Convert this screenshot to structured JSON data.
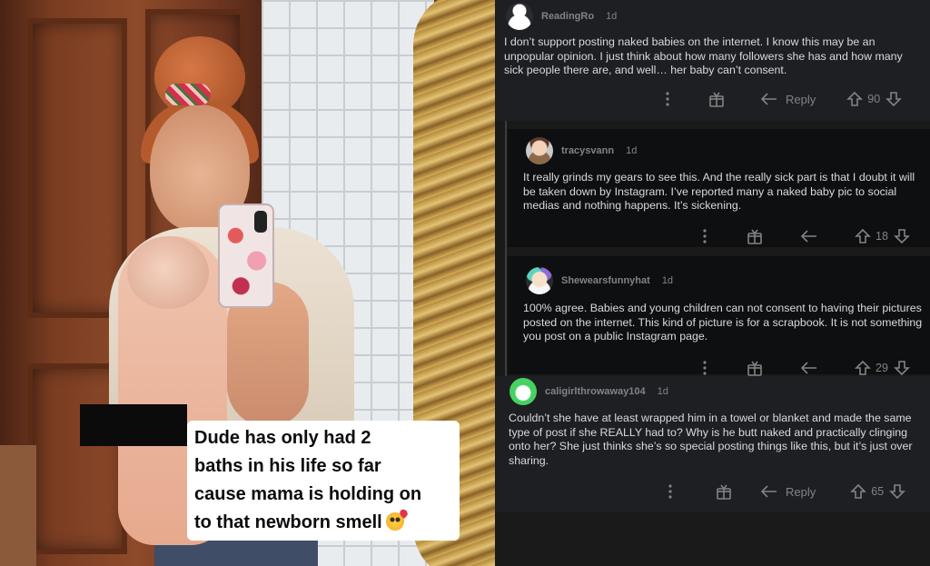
{
  "photo": {
    "caption_lines": [
      "Dude has only had 2",
      "baths in his life so far",
      "cause mama is holding on",
      "to that newborn smell"
    ],
    "caption_emoji": "smiling-face-with-hearts-icon"
  },
  "comments": [
    {
      "username": "ReadingRo",
      "age": "1d",
      "body": "I don’t support posting naked babies on the internet. I know this may be an unpopular opinion. I just think about how many followers she has and how many sick people there are, and well… her baby can’t consent.",
      "reply_label": "Reply",
      "votes": "90"
    },
    {
      "username": "tracysvann",
      "age": "1d",
      "body": "It really grinds my gears to see this. And the really sick part is that I doubt it will be taken down by Instagram. I’ve reported many a naked baby pic to social medias and nothing happens. It’s sickening.",
      "votes": "18"
    },
    {
      "username": "Shewearsfunnyhat",
      "age": "1d",
      "body": "100% agree. Babies and young children can not consent to having their pictures posted on the internet. This kind of picture is for a scrapbook. It is not something you post on a public Instagram page.",
      "votes": "29"
    },
    {
      "username": "caligirlthrowaway104",
      "age": "1d",
      "body": "Couldn’t she have at least wrapped him in a towel or blanket and made the same type of post if she REALLY had to? Why is he butt naked and practically clinging onto her? She just thinks she’s so special posting things like this, but it’s just over sharing.",
      "reply_label": "Reply",
      "votes": "65"
    }
  ],
  "colors": {
    "background": "#1a1a1b",
    "comment_text": "#d7dadc",
    "meta_text": "#818384"
  }
}
